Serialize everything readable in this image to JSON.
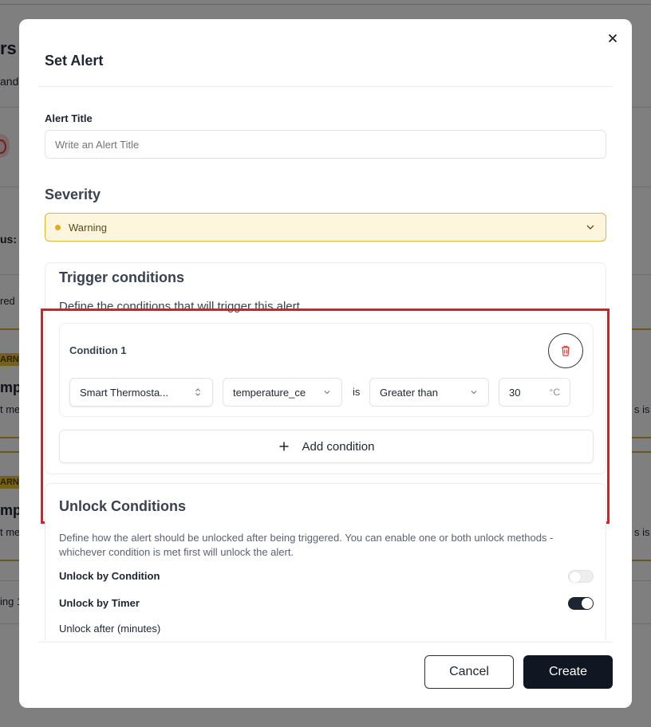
{
  "modal": {
    "title": "Set Alert",
    "close_icon": "close-icon"
  },
  "alert_title": {
    "label": "Alert Title",
    "placeholder": "Write an Alert Title",
    "value": ""
  },
  "severity": {
    "label": "Severity",
    "selected": "Warning",
    "dot_color": "#e2a91a",
    "icon": "chevron-down-icon"
  },
  "trigger": {
    "title": "Trigger conditions",
    "description": "Define the conditions that will trigger this alert",
    "conditions": [
      {
        "label": "Condition 1",
        "device": "Smart Thermosta...",
        "metric": "temperature_ce",
        "connector": "is",
        "operator": "Greater than",
        "value": "30",
        "unit": "°C",
        "delete_icon": "trash-icon"
      }
    ],
    "add_label": "Add condition",
    "add_icon": "plus-icon",
    "highlight_color": "#e8191b"
  },
  "unlock": {
    "title": "Unlock Conditions",
    "description": "Define how the alert should be unlocked after being triggered. You can enable one or both unlock methods - whichever condition is met first will unlock the alert.",
    "by_condition": {
      "label": "Unlock by Condition",
      "enabled": false
    },
    "by_timer": {
      "label": "Unlock by Timer",
      "enabled": true
    },
    "minutes_label": "Unlock after (minutes)"
  },
  "footer": {
    "cancel": "Cancel",
    "create": "Create"
  },
  "background": {
    "fragments": [
      "rs",
      "and",
      "us:",
      "red",
      "ARN",
      "mpe",
      "t me",
      "s is",
      "ARN",
      "mpe",
      "t me",
      "s is",
      "ing 1"
    ]
  }
}
